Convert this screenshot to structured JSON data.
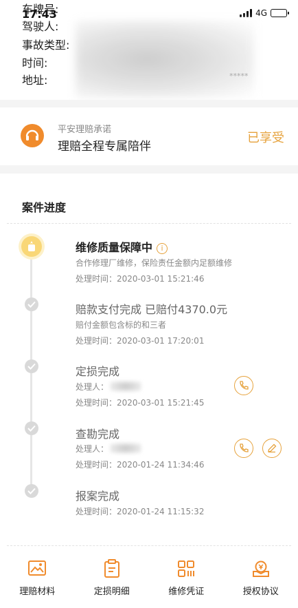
{
  "status_bar": {
    "time": "17:43",
    "network": "4G"
  },
  "case_info": {
    "labels": [
      "车牌号:",
      "驾驶人:",
      "事故类型:",
      "时间:",
      "地址:"
    ],
    "address_mask": "*****"
  },
  "promise": {
    "subtitle": "平安理赔承诺",
    "title": "理赔全程专属陪伴",
    "status": "已享受"
  },
  "progress": {
    "section_title": "案件进度",
    "steps": [
      {
        "title": "维修质量保障中",
        "info_symbol": "i",
        "desc": "合作修理厂维修，保险责任金额内足额维修",
        "time": "处理时间：2020-03-01 15:21:46"
      },
      {
        "title": "赔款支付完成 已赔付4370.0元",
        "desc": "赔付金额包含标的和三者",
        "time": "处理时间：2020-03-01 17:20:01"
      },
      {
        "title": "定损完成",
        "handler": "处理人：",
        "time": "处理时间：2020-03-01 15:21:45"
      },
      {
        "title": "查勘完成",
        "handler": "处理人：",
        "time": "处理时间：2020-01-24 11:34:46"
      },
      {
        "title": "报案完成",
        "time": "处理时间：2020-01-24 11:15:32"
      }
    ]
  },
  "bottom_tabs": [
    {
      "label": "理赔材料",
      "icon": "image-icon"
    },
    {
      "label": "定损明细",
      "icon": "clipboard-icon"
    },
    {
      "label": "维修凭证",
      "icon": "qr-code-icon"
    },
    {
      "label": "授权协议",
      "icon": "seal-icon"
    }
  ],
  "colors": {
    "accent": "#e6a23c",
    "orange_icon": "#f08b2c",
    "active_node": "#f9d777"
  }
}
